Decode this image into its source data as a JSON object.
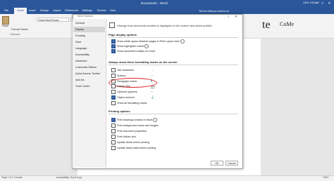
{
  "window": {
    "title": "Document1 - Word",
    "user_date": "10/21 9:52 AM"
  },
  "tabs": [
    "File",
    "Home",
    "Insert",
    "Design",
    "Layout",
    "References",
    "Mailings",
    "Review",
    "View"
  ],
  "tell_me": "Tell me what you want to do",
  "ribbon": {
    "paste_label": "Paste",
    "font_name": "Times New Roman",
    "font_size": "12",
    "clipboard_label": "Clipboard",
    "format_painter": "Format Painter",
    "style_preview": "te",
    "style_preview2": "CoMe"
  },
  "dialog": {
    "title": "Word Options",
    "help": "?",
    "close": "✕",
    "header_text": "Change how document content is displayed on the screen and when printed.",
    "nav": [
      "General",
      "Display",
      "Proofing",
      "Save",
      "Language",
      "Accessibility",
      "Advanced",
      "Customize Ribbon",
      "Quick Access Toolbar",
      "Add-ins",
      "Trust Center"
    ],
    "selected_nav": "Display",
    "sections": {
      "page_display": "Page display options",
      "formatting": "Always show these formatting marks on the screen",
      "printing": "Printing options"
    },
    "page_display_options": [
      {
        "label": "Show white space between pages in Print Layout view",
        "checked": true,
        "info": true
      },
      {
        "label": "Show highlighter marks",
        "checked": true,
        "info": true
      },
      {
        "label": "Show document tooltips on hover",
        "checked": true,
        "info": false
      }
    ],
    "formatting_marks": [
      {
        "label": "Tab characters",
        "checked": false,
        "mark": "→"
      },
      {
        "label": "Spaces",
        "checked": false,
        "mark": "···"
      },
      {
        "label": "Paragraph marks",
        "checked": false,
        "mark": "¶"
      },
      {
        "label": "Hidden text",
        "checked": false,
        "mark": "abc"
      },
      {
        "label": "Optional hyphens",
        "checked": false,
        "mark": "¬"
      },
      {
        "label": "Object anchors",
        "checked": true,
        "mark": "⚓"
      },
      {
        "label": "Show all formatting marks",
        "checked": false,
        "mark": ""
      }
    ],
    "printing_options": [
      {
        "label": "Print drawings created in Word",
        "checked": true,
        "info": true
      },
      {
        "label": "Print background colors and images",
        "checked": false,
        "info": false
      },
      {
        "label": "Print document properties",
        "checked": false,
        "info": false
      },
      {
        "label": "Print hidden text",
        "checked": false,
        "info": false
      },
      {
        "label": "Update fields before printing",
        "checked": false,
        "info": false
      },
      {
        "label": "Update linked data before printing",
        "checked": false,
        "info": false
      }
    ],
    "ok_label": "OK",
    "cancel_label": "Cancel"
  },
  "status": {
    "page_info": "Page 1 of 1   0 words",
    "accessibility": "Accessibility: Good to go",
    "zoom": "100%"
  },
  "colors": {
    "brand": "#2b579a",
    "annotation": "#dd2222"
  }
}
